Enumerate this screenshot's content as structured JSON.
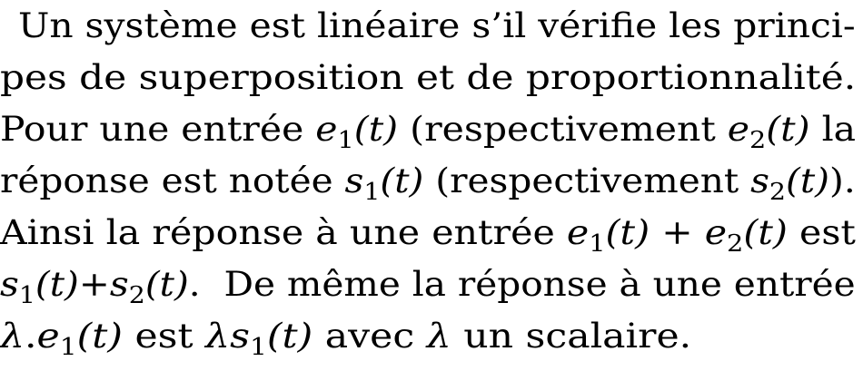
{
  "paragraph": {
    "line1": "Un système est linéaire s’il vérifie les princi-",
    "line2": "pes de superposition et de proportionnalité.",
    "line3": {
      "a": "Pour une entrée ",
      "e1_var": "e",
      "e1_sub": "1",
      "e1_arg": "(t)",
      "b": " (respectivement ",
      "e2_var": "e",
      "e2_sub": "2",
      "e2_arg": "(t)",
      "c": " la"
    },
    "line4": {
      "a": "réponse est notée ",
      "s1_var": "s",
      "s1_sub": "1",
      "s1_arg": "(t)",
      "b": " (respectivement ",
      "s2_var": "s",
      "s2_sub": "2",
      "s2_arg": "(t)",
      "c": ")."
    },
    "line5": {
      "a": "Ainsi la réponse à une entrée ",
      "e1_var": "e",
      "e1_sub": "1",
      "e1_arg": "(t)",
      "op": " + ",
      "e2_var": "e",
      "e2_sub": "2",
      "e2_arg": "(t)",
      "b": " est"
    },
    "line6": {
      "s1_var": "s",
      "s1_sub": "1",
      "s1_arg": "(t)",
      "op": "+",
      "s2_var": "s",
      "s2_sub": "2",
      "s2_arg": "(t)",
      "a": ".  De même la réponse à une entrée"
    },
    "line7": {
      "lambda1": "λ",
      "dot": ".",
      "e1_var": "e",
      "e1_sub": "1",
      "e1_arg": "(t)",
      "a": " est ",
      "lambda2": "λ",
      "s1_var": "s",
      "s1_sub": "1",
      "s1_arg": "(t)",
      "b": " avec ",
      "lambda3": "λ",
      "c": " un scalaire."
    }
  }
}
